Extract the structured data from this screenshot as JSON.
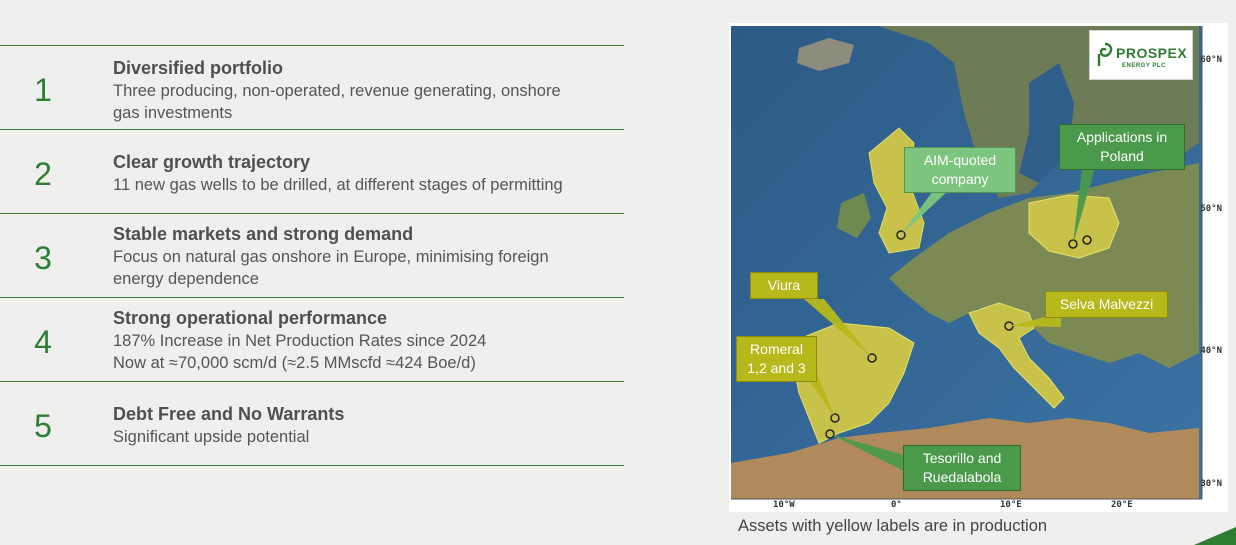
{
  "highlights": [
    {
      "number": "1",
      "title": "Diversified portfolio",
      "lines": [
        "Three producing, non-operated, revenue generating, onshore",
        "gas investments"
      ]
    },
    {
      "number": "2",
      "title": "Clear growth trajectory",
      "lines": [
        "11 new gas wells to be drilled, at different stages of permitting"
      ]
    },
    {
      "number": "3",
      "title": "Stable markets and strong demand",
      "lines": [
        "Focus on natural gas onshore in Europe, minimising foreign",
        "energy dependence"
      ]
    },
    {
      "number": "4",
      "title": "Strong operational performance",
      "lines": [
        "187% Increase in Net Production Rates since 2024",
        "Now at ≈70,000 scm/d (≈2.5 MMscfd ≈424 Boe/d)"
      ]
    },
    {
      "number": "5",
      "title": "Debt Free and No Warrants",
      "lines": [
        "Significant upside potential"
      ]
    }
  ],
  "map": {
    "logo": {
      "name": "PROSPEX",
      "subtitle": "ENERGY PLC"
    },
    "latitude_ticks": [
      "60°N",
      "50°N",
      "40°N",
      "30°N"
    ],
    "longitude_ticks": [
      "10°W",
      "0°",
      "10°E",
      "20°E"
    ],
    "labels": {
      "aim": [
        "AIM-quoted",
        "company"
      ],
      "poland": [
        "Applications in",
        "Poland"
      ],
      "viura": [
        "Viura"
      ],
      "selva": [
        "Selva Malvezzi"
      ],
      "romeral": [
        "Romeral",
        "1,2 and 3"
      ],
      "tesorillo": [
        "Tesorillo and",
        "Ruedalabola"
      ]
    },
    "caption": "Assets with yellow labels are in production",
    "colors": {
      "production": "#b7b81a",
      "application": "#4b9a4b",
      "corporate": "#7cc57e",
      "accent": "#2e7d32"
    }
  }
}
